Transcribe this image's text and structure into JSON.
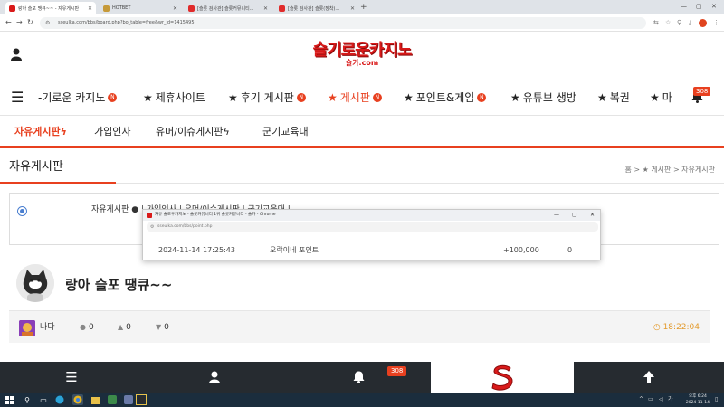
{
  "browser": {
    "tabs": [
      {
        "title": "랑아 슬포 땡큐~~ - 자유게시판",
        "color": "#d91a1a",
        "active": true
      },
      {
        "title": "HOTBET",
        "color": "#c69a3a",
        "active": false
      },
      {
        "title": "[슬롯 검사관] 슬롯커뮤니티...",
        "color": "#e02b2b",
        "active": false
      },
      {
        "title": "[슬롯 검사관] 슬롯(장착)...",
        "color": "#e02b2b",
        "active": false
      }
    ],
    "url": "sseulka.com/bbs/board.php?bo_table=free&wr_id=1415495"
  },
  "site": {
    "logo_main": "슬기로운카지노",
    "logo_sub": "슬카.com"
  },
  "mainnav": {
    "items": [
      {
        "label": "-기로운 카지노",
        "badge": "N",
        "star": false,
        "active": false
      },
      {
        "label": "제휴사이트",
        "badge": "",
        "star": true,
        "active": false
      },
      {
        "label": "후기 게시판",
        "badge": "N",
        "star": true,
        "active": false
      },
      {
        "label": "게시판",
        "badge": "N",
        "star": true,
        "active": true
      },
      {
        "label": "포인트&게임",
        "badge": "N",
        "star": true,
        "active": false
      },
      {
        "label": "유튜브 생방",
        "badge": "",
        "star": true,
        "active": false
      },
      {
        "label": "복권",
        "badge": "",
        "star": true,
        "active": false
      },
      {
        "label": "마",
        "badge": "",
        "star": true,
        "active": false
      }
    ],
    "notif_count": "308"
  },
  "subnav": {
    "items": [
      {
        "label": "자유게시판",
        "active": true
      },
      {
        "label": "가입인사",
        "active": false
      },
      {
        "label": "유머/이슈게시판",
        "active": false
      },
      {
        "label": "군기교육대",
        "active": false
      }
    ]
  },
  "board": {
    "title": "자유게시판",
    "breadcrumb": "홈 > ★ 게시판 > 자유게시판"
  },
  "category_box": {
    "text": "자유게시판 ●  |  가입인사  |  유머/이슈게시판  |  군기교육대  |"
  },
  "popup": {
    "title": "자유 슬로우카지노 - 슬롯커뮤니티 1위 슬롯커뮤니티 - 슬카 - Chrome",
    "url": "sseulka.com/bbs/point.php",
    "row": {
      "date": "2024-11-14 17:25:43",
      "desc": "오락이네 포인트",
      "amount": "+100,000",
      "balance": "0"
    }
  },
  "post": {
    "title": "랑아 슬포 땡큐~~",
    "author": "나다",
    "comments": "0",
    "likes": "0",
    "dislikes": "0",
    "time": "18:22:04"
  },
  "bottombar": {
    "notif_count": "308"
  },
  "taskbar": {
    "time": "오후 6:24",
    "date": "2024-11-14"
  },
  "colors": {
    "accent": "#e8401f",
    "brand_red": "#d91a1a",
    "time_color": "#e39a2b",
    "bottombar": "#262b30",
    "taskbar": "#1b2d3d"
  }
}
